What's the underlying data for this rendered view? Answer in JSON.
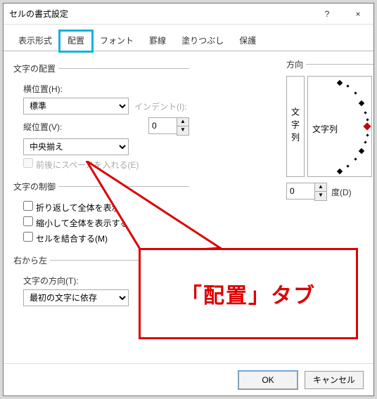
{
  "window": {
    "title": "セルの書式設定",
    "help": "?",
    "close": "×"
  },
  "tabs": {
    "items": [
      {
        "label": "表示形式"
      },
      {
        "label": "配置"
      },
      {
        "label": "フォント"
      },
      {
        "label": "罫線"
      },
      {
        "label": "塗りつぶし"
      },
      {
        "label": "保護"
      }
    ],
    "active_index": 1
  },
  "groups": {
    "alignment": {
      "legend": "文字の配置",
      "horiz_label": "横位置(H):",
      "horiz_value": "標準",
      "indent_label": "インデント(I):",
      "indent_value": "0",
      "vert_label": "縦位置(V):",
      "vert_value": "中央揃え",
      "justify_label": "前後にスペースを入れる(E)"
    },
    "control": {
      "legend": "文字の制御",
      "wrap": "折り返して全体を表示する(W)",
      "shrink": "縮小して全体を表示する(K)",
      "merge": "セルを結合する(M)"
    },
    "rtl": {
      "legend": "右から左",
      "dir_label": "文字の方向(T):",
      "dir_value": "最初の文字に依存"
    },
    "orientation": {
      "legend": "方向",
      "vtext": "文字列",
      "htext": "文字列",
      "degree_value": "0",
      "degree_label": "度(D)"
    }
  },
  "callout": {
    "text": "「配置」タブ"
  },
  "footer": {
    "ok": "OK",
    "cancel": "キャンセル"
  }
}
